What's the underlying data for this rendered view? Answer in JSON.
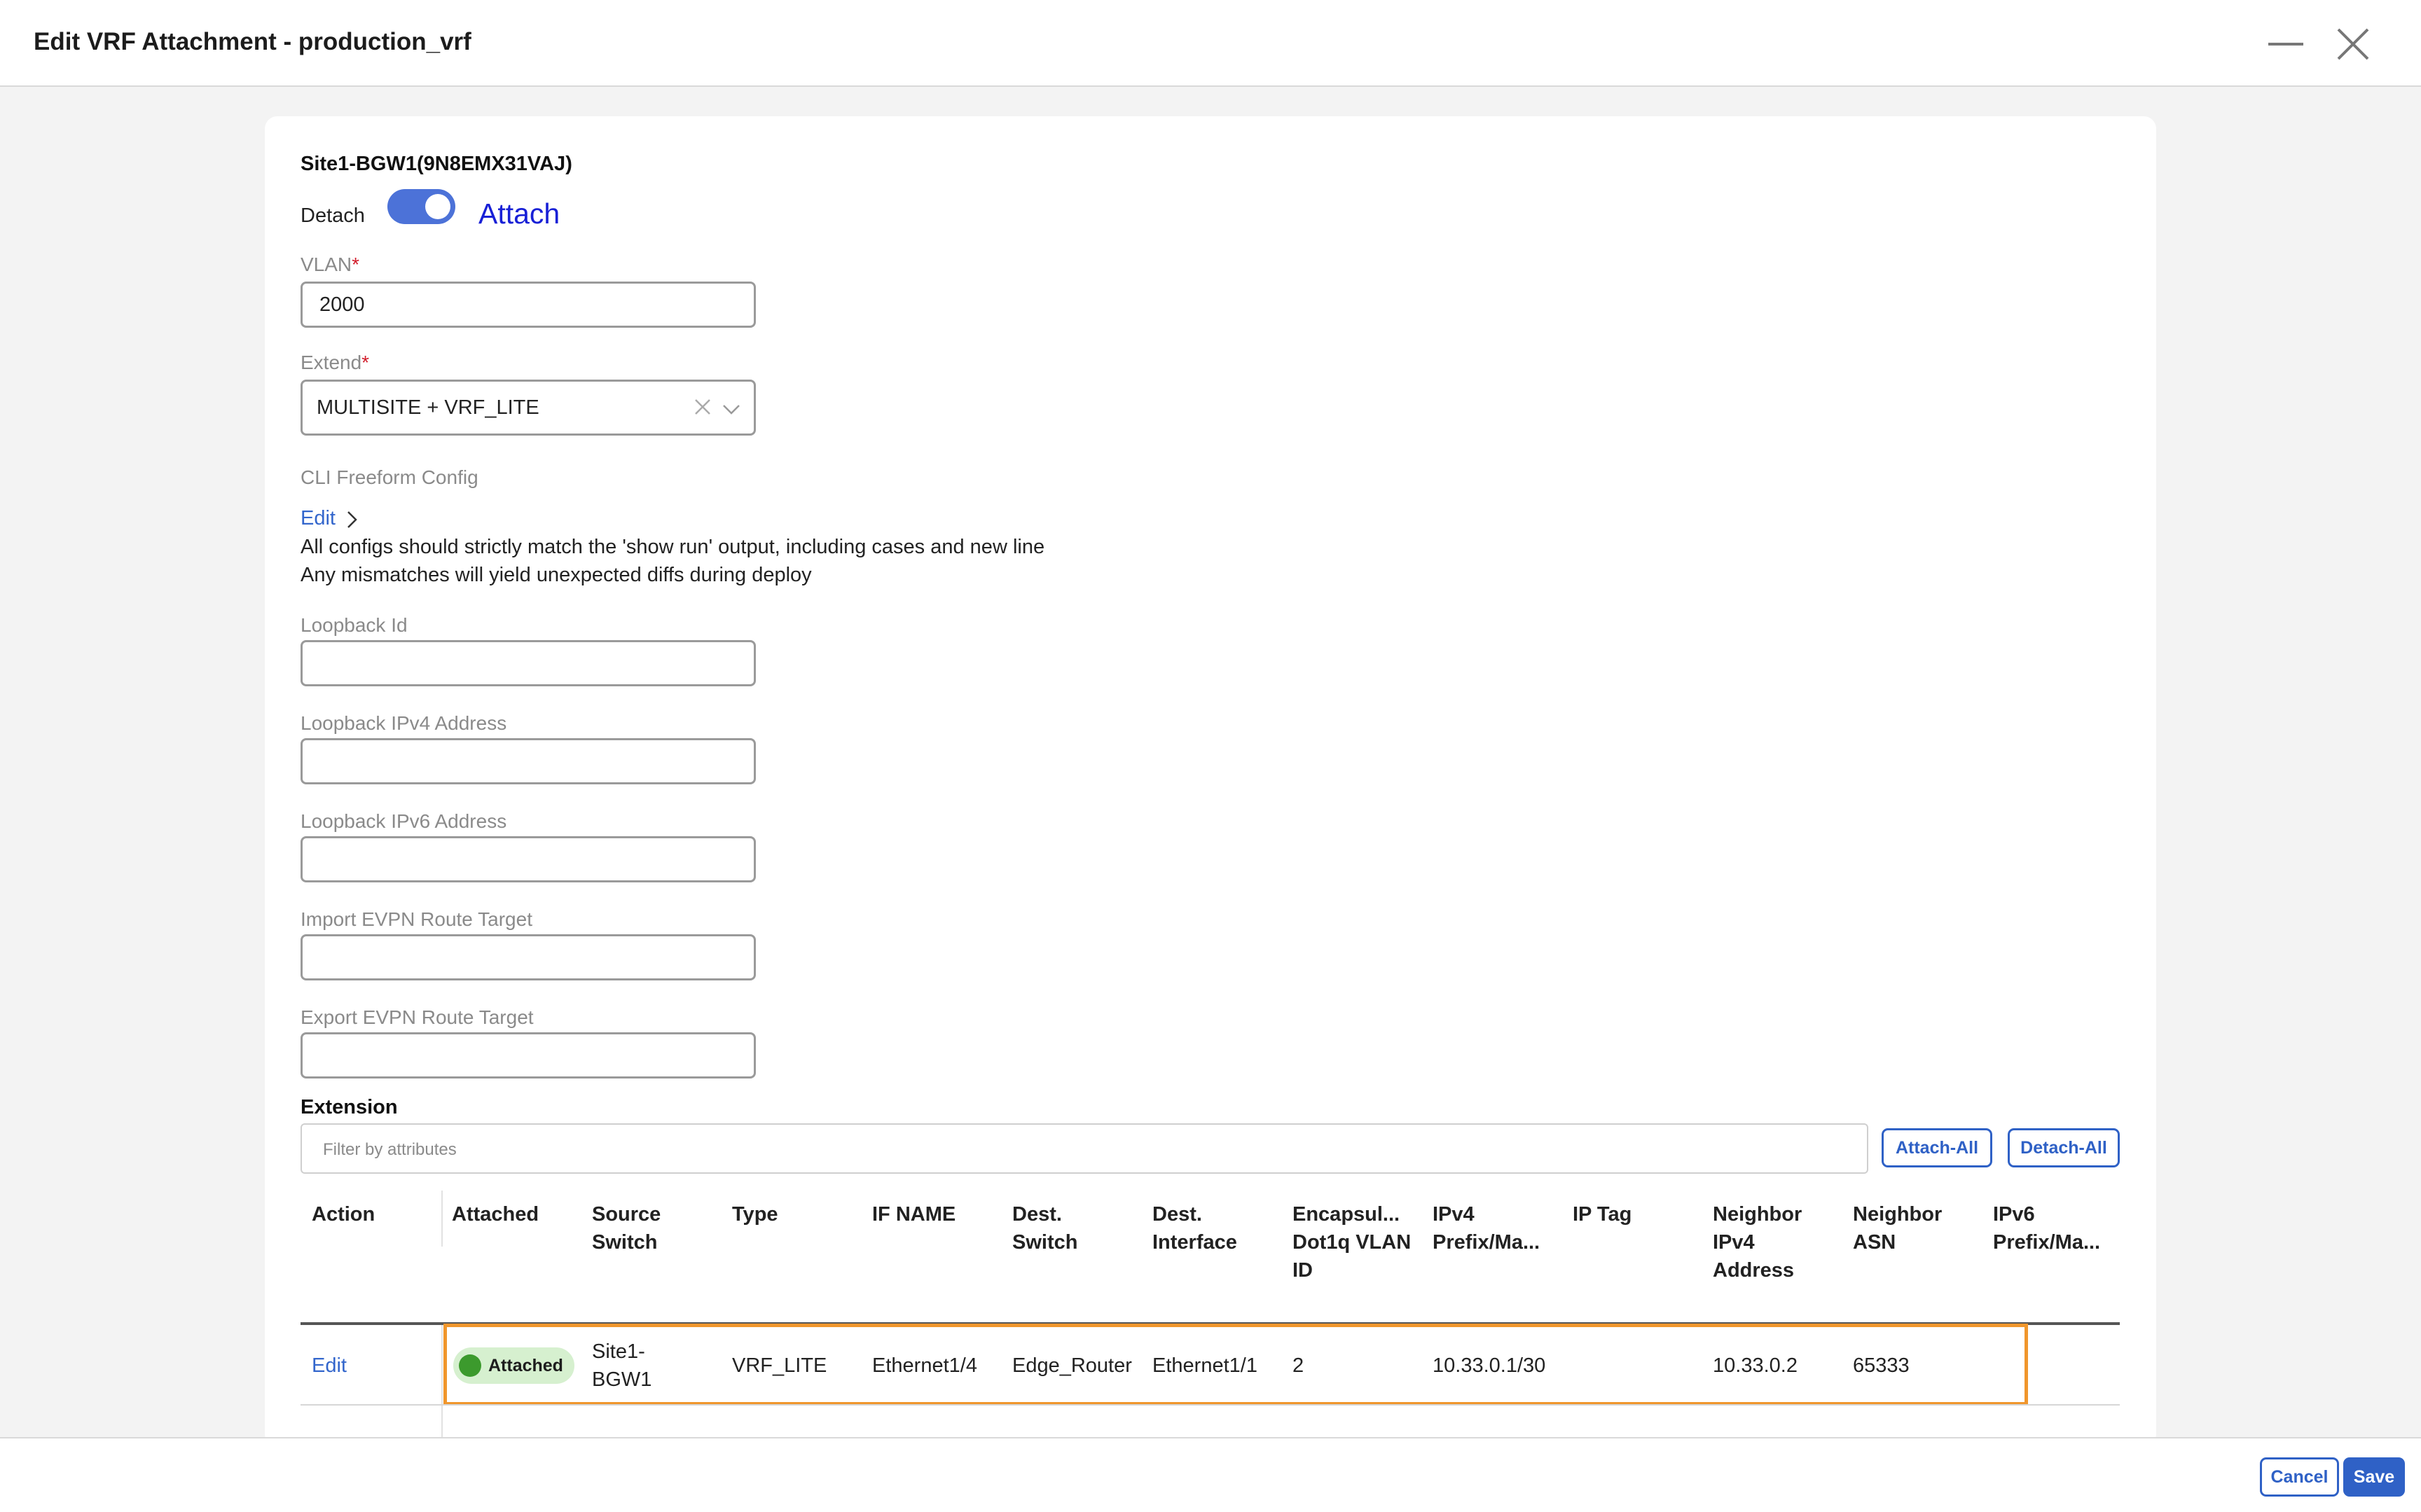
{
  "header": {
    "title": "Edit VRF Attachment - production_vrf"
  },
  "device": {
    "title": "Site1-BGW1(9N8EMX31VAJ)",
    "detach_label": "Detach",
    "attach_label": "Attach",
    "attached": true
  },
  "form": {
    "vlan": {
      "label": "VLAN",
      "required_mark": "*",
      "value": "2000"
    },
    "extend": {
      "label": "Extend",
      "required_mark": "*",
      "value": "MULTISITE + VRF_LITE"
    },
    "cli_freeform": {
      "label": "CLI Freeform Config",
      "edit_label": "Edit",
      "note_line1": "All configs should strictly match the 'show run' output, including cases and new line",
      "note_line2": "Any mismatches will yield unexpected diffs during deploy"
    },
    "loopback_id": {
      "label": "Loopback Id",
      "value": ""
    },
    "loopback_ipv4": {
      "label": "Loopback IPv4 Address",
      "value": ""
    },
    "loopback_ipv6": {
      "label": "Loopback IPv6 Address",
      "value": ""
    },
    "import_rt": {
      "label": "Import EVPN Route Target",
      "value": ""
    },
    "export_rt": {
      "label": "Export EVPN Route Target",
      "value": ""
    }
  },
  "extension": {
    "title": "Extension",
    "filter_placeholder": "Filter by attributes",
    "attach_all_label": "Attach-All",
    "detach_all_label": "Detach-All",
    "columns": {
      "action": "Action",
      "attached": "Attached",
      "source_switch": "Source Switch",
      "type": "Type",
      "if_name": "IF NAME",
      "dest_switch": "Dest. Switch",
      "dest_interface": "Dest. Interface",
      "encap": "Encapsul... Dot1q VLAN ID",
      "ipv4_prefix": "IPv4 Prefix/Ma...",
      "ip_tag": "IP Tag",
      "neighbor_ipv4": "Neighbor IPv4 Address",
      "neighbor_asn": "Neighbor ASN",
      "ipv6_prefix": "IPv6 Prefix/Ma..."
    },
    "rows": [
      {
        "action": "Edit",
        "attached": "Attached",
        "source_switch": "Site1-BGW1",
        "type": "VRF_LITE",
        "if_name": "Ethernet1/4",
        "dest_switch": "Edge_Router",
        "dest_interface": "Ethernet1/1",
        "encap": "2",
        "ipv4_prefix": "10.33.0.1/30",
        "ip_tag": "",
        "neighbor_ipv4": "10.33.0.2",
        "neighbor_asn": "65333",
        "ipv6_prefix": ""
      }
    ]
  },
  "footer": {
    "cancel_label": "Cancel",
    "save_label": "Save"
  },
  "icons": {
    "minimize": "minimize-icon",
    "close": "close-icon",
    "clear": "clear-icon",
    "chevron_down": "chevron-down-icon",
    "chevron_right": "chevron-right-icon"
  },
  "colors": {
    "accent": "#2f61c6",
    "toggle": "#4c72d8",
    "attach_text": "#1820d6",
    "required": "#d21d2b",
    "status_attached_bg": "#d6f0cf",
    "status_attached_dot": "#3c9a2d",
    "row_highlight": "#f0962c"
  }
}
